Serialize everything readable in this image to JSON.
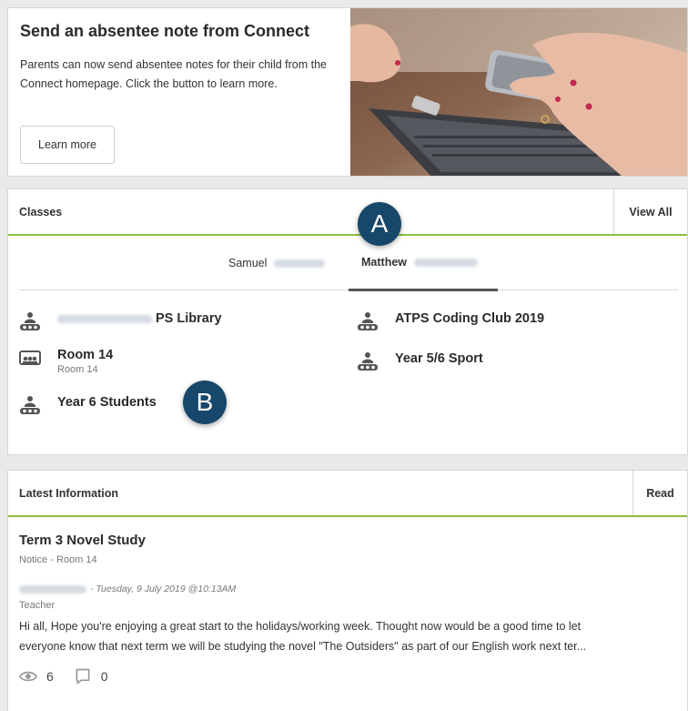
{
  "banner": {
    "title": "Send an absentee note from Connect",
    "body": "Parents can now send absentee notes for their child from the Connect homepage. Click the button to learn more.",
    "button_label": "Learn more"
  },
  "classes": {
    "header": "Classes",
    "view_all_label": "View All",
    "tabs": [
      {
        "label": "Samuel",
        "active": false
      },
      {
        "label": "Matthew",
        "active": true
      }
    ],
    "items": [
      {
        "name": "PS Library",
        "subtitle": "",
        "icon": "group-icon"
      },
      {
        "name": "ATPS Coding Club 2019",
        "subtitle": "",
        "icon": "group-icon"
      },
      {
        "name": "Room 14",
        "subtitle": "Room 14",
        "icon": "classroom-icon"
      },
      {
        "name": "Year 5/6 Sport",
        "subtitle": "",
        "icon": "group-icon"
      },
      {
        "name": "Year 6 Students",
        "subtitle": "",
        "icon": "group-icon"
      }
    ]
  },
  "callouts": {
    "a": "A",
    "b": "B"
  },
  "latest": {
    "header": "Latest Information",
    "read_label": "Read",
    "notice": {
      "title": "Term 3 Novel Study",
      "subtitle": "Notice - Room 14",
      "date": "- Tuesday, 9 July 2019 @10:13AM",
      "role": "Teacher",
      "body_line1": "Hi all, Hope you're enjoying a great start to the holidays/working week. Thought now would be a good time to let",
      "body_line2": "everyone know that next term we will be studying the novel \"The Outsiders\" as part of our English work next ter...",
      "views": "6",
      "comments": "0"
    }
  },
  "colors": {
    "accent_green": "#8cbe3f",
    "callout_blue": "#17476a"
  }
}
